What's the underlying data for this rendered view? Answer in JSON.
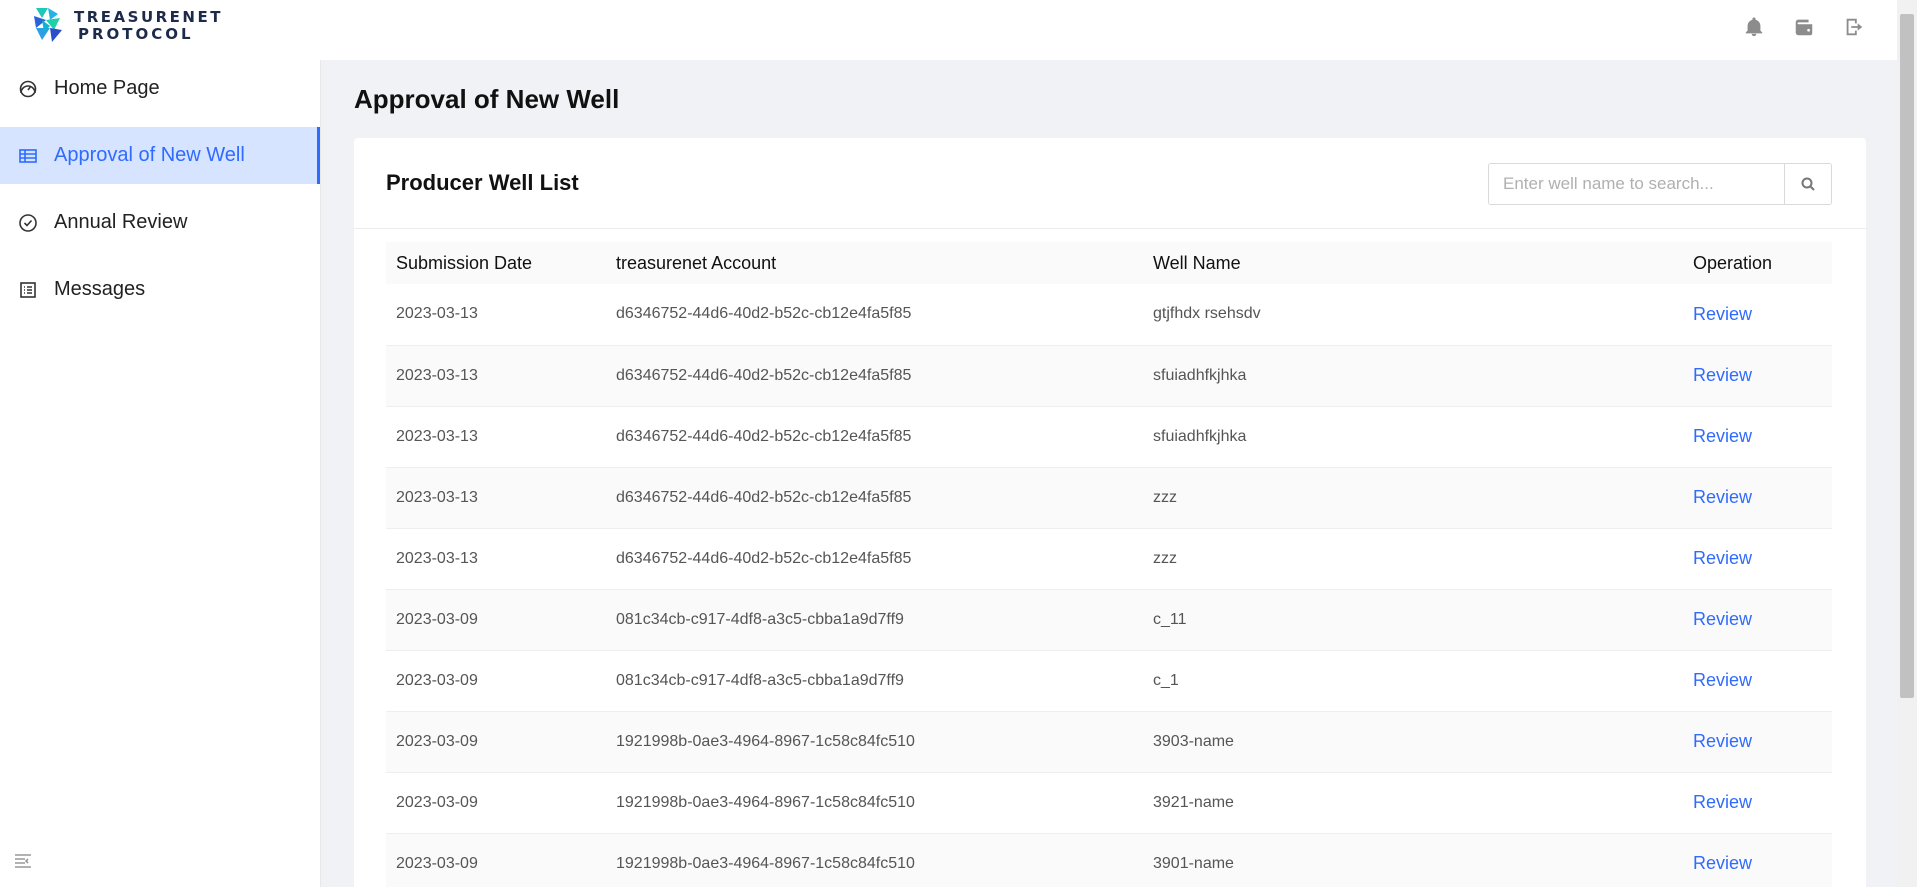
{
  "brand": {
    "line1": "TREASURENET",
    "line2": "PROTOCOL"
  },
  "header": {
    "icons": [
      "bell-icon",
      "wallet-icon",
      "logout-icon"
    ]
  },
  "sidebar": {
    "items": [
      {
        "label": "Home Page",
        "icon": "gauge-icon",
        "active": false
      },
      {
        "label": "Approval of New Well",
        "icon": "table-icon",
        "active": true
      },
      {
        "label": "Annual Review",
        "icon": "check-circle-icon",
        "active": false
      },
      {
        "label": "Messages",
        "icon": "list-icon",
        "active": false
      }
    ]
  },
  "main": {
    "title": "Approval of New Well",
    "card_title": "Producer Well List",
    "search": {
      "placeholder": "Enter well name to search..."
    },
    "columns": [
      "Submission Date",
      "treasurenet Account",
      "Well Name",
      "Operation"
    ],
    "rows": [
      {
        "date": "2023-03-13",
        "account": "d6346752-44d6-40d2-b52c-cb12e4fa5f85",
        "well": "gtjfhdx rsehsdv",
        "op": "Review"
      },
      {
        "date": "2023-03-13",
        "account": "d6346752-44d6-40d2-b52c-cb12e4fa5f85",
        "well": "sfuiadhfkjhka",
        "op": "Review"
      },
      {
        "date": "2023-03-13",
        "account": "d6346752-44d6-40d2-b52c-cb12e4fa5f85",
        "well": "sfuiadhfkjhka",
        "op": "Review"
      },
      {
        "date": "2023-03-13",
        "account": "d6346752-44d6-40d2-b52c-cb12e4fa5f85",
        "well": "zzz",
        "op": "Review"
      },
      {
        "date": "2023-03-13",
        "account": "d6346752-44d6-40d2-b52c-cb12e4fa5f85",
        "well": "zzz",
        "op": "Review"
      },
      {
        "date": "2023-03-09",
        "account": "081c34cb-c917-4df8-a3c5-cbba1a9d7ff9",
        "well": "c_11",
        "op": "Review"
      },
      {
        "date": "2023-03-09",
        "account": "081c34cb-c917-4df8-a3c5-cbba1a9d7ff9",
        "well": "c_1",
        "op": "Review"
      },
      {
        "date": "2023-03-09",
        "account": "1921998b-0ae3-4964-8967-1c58c84fc510",
        "well": "3903-name",
        "op": "Review"
      },
      {
        "date": "2023-03-09",
        "account": "1921998b-0ae3-4964-8967-1c58c84fc510",
        "well": "3921-name",
        "op": "Review"
      },
      {
        "date": "2023-03-09",
        "account": "1921998b-0ae3-4964-8967-1c58c84fc510",
        "well": "3901-name",
        "op": "Review"
      }
    ]
  },
  "colors": {
    "accent": "#2f6bff",
    "active_bg": "#d6e4ff"
  }
}
